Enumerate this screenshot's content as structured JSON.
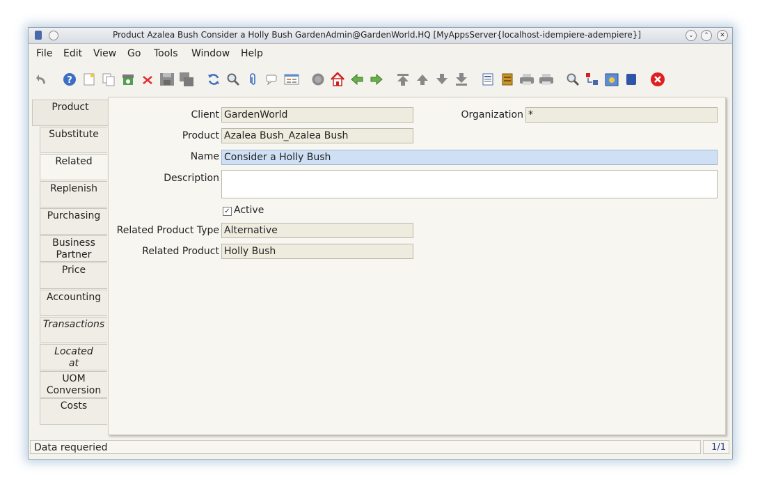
{
  "window": {
    "title": "Product  Azalea Bush  Consider a Holly Bush  GardenAdmin@GardenWorld.HQ [MyAppsServer{localhost-idempiere-adempiere}]"
  },
  "menu": {
    "file": "File",
    "edit": "Edit",
    "view": "View",
    "go": "Go",
    "tools": "Tools",
    "window": "Window",
    "help": "Help"
  },
  "toolbar": {
    "icons": [
      "undo-icon",
      "help-icon",
      "new-icon",
      "copy-icon",
      "archive-icon",
      "delete-icon",
      "save-icon",
      "save-new-icon",
      "refresh-icon",
      "find-icon",
      "attachment-icon",
      "chat-icon",
      "grid-toggle-icon",
      "history-icon",
      "home-icon",
      "parent-icon",
      "detail-icon",
      "first-icon",
      "previous-icon",
      "next-icon",
      "last-icon",
      "report-icon",
      "archived-docs-icon",
      "print-preview-icon",
      "print-icon",
      "zoom-across-icon",
      "request-icon",
      "product-info-icon",
      "workflow-icon",
      "end-icon"
    ]
  },
  "tabs": [
    {
      "label": "Product"
    },
    {
      "label": "Substitute"
    },
    {
      "label": "Related"
    },
    {
      "label": "Replenish"
    },
    {
      "label": "Purchasing"
    },
    {
      "label_1": "Business",
      "label_2": "Partner"
    },
    {
      "label": "Price"
    },
    {
      "label": "Accounting"
    },
    {
      "label": "Transactions"
    },
    {
      "label_1": "Located",
      "label_2": "at"
    },
    {
      "label_1": "UOM",
      "label_2": "Conversion"
    },
    {
      "label": "Costs"
    }
  ],
  "form": {
    "client_label": "Client",
    "client_value": "GardenWorld",
    "organization_label": "Organization",
    "organization_value": "*",
    "product_label": "Product",
    "product_value": "Azalea Bush_Azalea Bush",
    "name_label": "Name",
    "name_value": "Consider a Holly Bush",
    "description_label": "Description",
    "description_value": "",
    "active_label": "Active",
    "active_checked": true,
    "related_type_label": "Related Product Type",
    "related_type_value": "Alternative",
    "related_product_label": "Related Product",
    "related_product_value": "Holly Bush"
  },
  "status": {
    "message": "Data requeried",
    "record_count": "1/1"
  },
  "colors": {
    "accent": "#cfe0f5",
    "readonly": "#eeecdf",
    "background": "#f7f6f1"
  }
}
